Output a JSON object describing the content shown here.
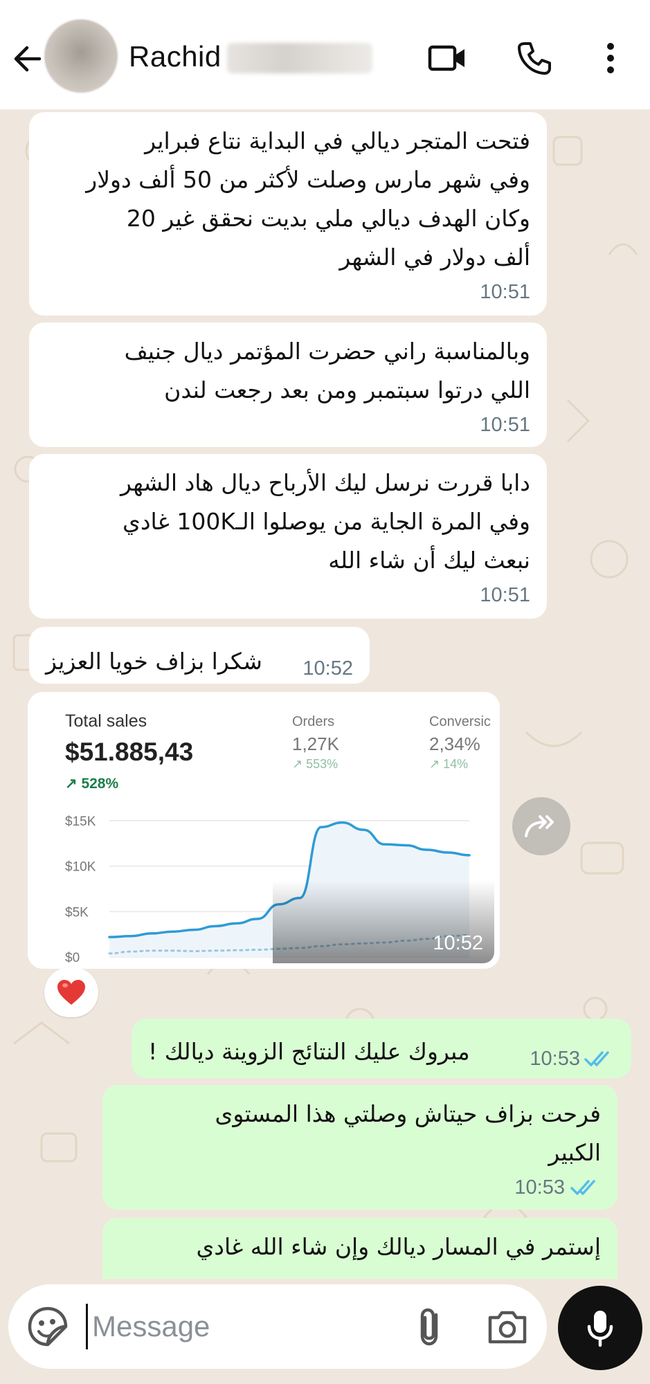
{
  "header": {
    "contact_name": "Rachid",
    "icons": [
      "back-arrow-icon",
      "video-call-icon",
      "phone-icon",
      "more-vert-icon"
    ]
  },
  "messages": [
    {
      "direction": "in",
      "text": "فتحت المتجر ديالي في البداية نتاع فبراير\nوفي شهر مارس وصلت لأكثر من 50 ألف  دولار\nوكان الهدف ديالي ملي بديت نحقق غير 20\nألف دولار في الشهر",
      "time": "10:51"
    },
    {
      "direction": "in",
      "text": "وبالمناسبة راني حضرت المؤتمر ديال جنيف\nاللي درتوا سبتمبر ومن بعد رجعت لندن",
      "time": "10:51"
    },
    {
      "direction": "in",
      "text": "دابا قررت نرسل ليك الأرباح ديال هاد الشهر\nوفي المرة الجاية من يوصلوا الـ100K غادي\nنبعث ليك أن شاء الله",
      "time": "10:51"
    },
    {
      "direction": "in",
      "text": "شكرا بزاف خويا العزيز",
      "time": "10:52"
    },
    {
      "direction": "out",
      "text": "مبروك عليك النتائج الزوينة ديالك !",
      "time": "10:53",
      "status": "read"
    },
    {
      "direction": "out",
      "text": "فرحت بزاف حيتاش وصلتي هذا المستوى\nالكبير",
      "time": "10:53",
      "status": "read"
    },
    {
      "direction": "out",
      "text": "إستمر في المسار ديالك وإن شاء الله غادي",
      "time": "",
      "status": ""
    }
  ],
  "image_message": {
    "time": "10:52",
    "reaction": "❤️",
    "metrics": [
      {
        "label": "Total sales",
        "value": "$51.885,43",
        "change": "528%"
      },
      {
        "label": "Orders",
        "value": "1,27K",
        "change": "553%"
      },
      {
        "label": "Conversic",
        "value": "2,34%",
        "change": "14%"
      }
    ]
  },
  "chart_data": {
    "type": "line",
    "title": "",
    "xlabel": "",
    "ylabel": "",
    "ylim": [
      0,
      15000
    ],
    "yticks": [
      "$15K",
      "$10K",
      "$5K",
      "$0"
    ],
    "series": [
      {
        "values": [
          2200,
          2300,
          2600,
          2800,
          3000,
          3400,
          3700,
          4200,
          5800,
          6500,
          14300,
          14800,
          14000,
          12400,
          12300,
          11800,
          11500,
          11200
        ]
      },
      {
        "values": [
          400,
          600,
          700,
          700,
          650,
          700,
          750,
          800,
          900,
          1000,
          1200,
          1400,
          1500,
          1600,
          1800,
          2000,
          2300,
          2400
        ]
      }
    ],
    "colors": [
      "#2f9bd6",
      "#9ac7de"
    ],
    "grid": true
  },
  "input": {
    "placeholder": "Message",
    "value": ""
  },
  "colors": {
    "incoming_bubble": "#ffffff",
    "outgoing_bubble": "#d9fdd3",
    "read_ticks": "#53bdeb",
    "background": "#efe7dd",
    "positive_change": "#1a7f4b"
  }
}
